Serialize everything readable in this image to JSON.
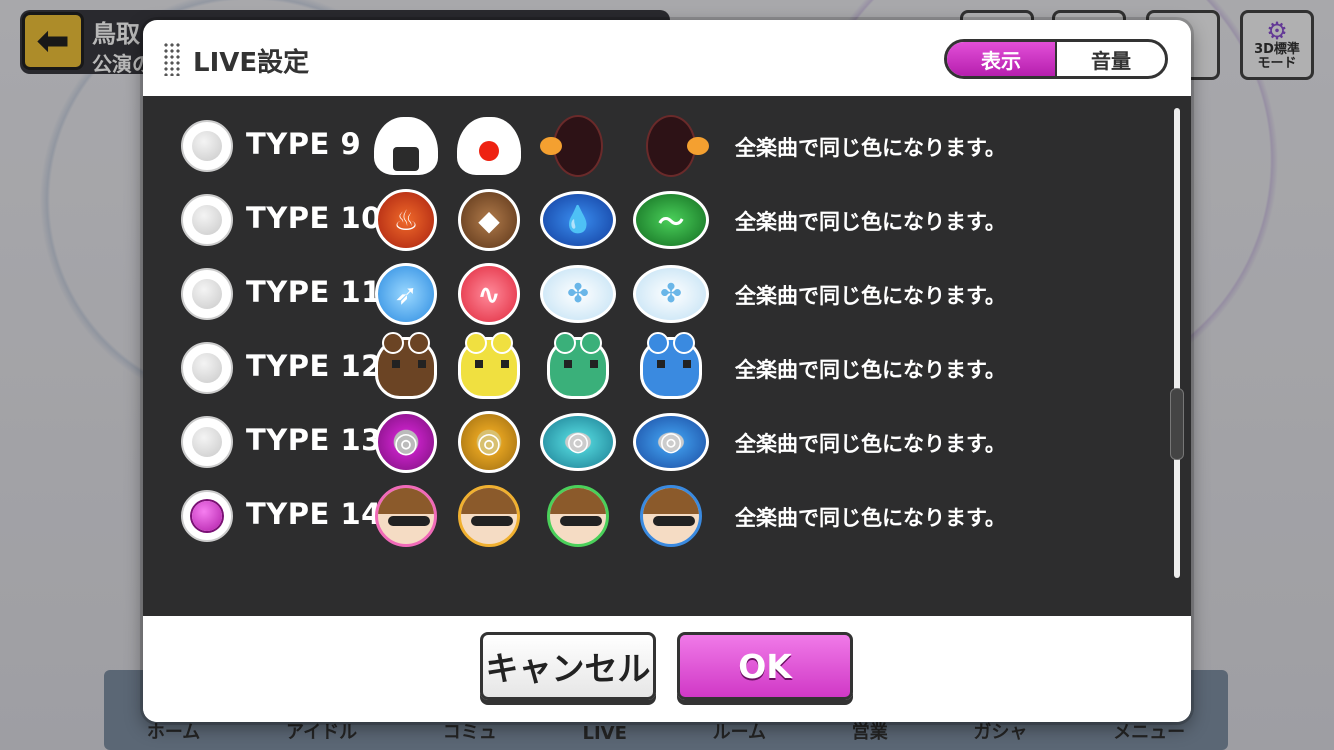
{
  "background": {
    "title": "鳥取",
    "subtitle": "公演の",
    "corner_button": "3D標準\nモード",
    "nav": [
      "ホーム",
      "アイドル",
      "コミュ",
      "LIVE",
      "ルーム",
      "営業",
      "ガシャ",
      "メニュー"
    ]
  },
  "dialog": {
    "title": "LIVE設定",
    "tabs": [
      {
        "label": "表示",
        "active": true
      },
      {
        "label": "音量",
        "active": false
      }
    ],
    "options": [
      {
        "label": "TYPE 9",
        "description": "全楽曲で同じ色になります。",
        "selected": false,
        "icons": [
          "onigiri-nori-icon",
          "onigiri-ume-icon",
          "onigiri-shrimp-left-icon",
          "onigiri-shrimp-right-icon"
        ]
      },
      {
        "label": "TYPE 10",
        "description": "全楽曲で同じ色になります。",
        "selected": false,
        "icons": [
          "fire-emblem-icon",
          "earth-emblem-icon",
          "water-emblem-icon",
          "wind-emblem-icon"
        ]
      },
      {
        "label": "TYPE 11",
        "description": "全楽曲で同じ色になります。",
        "selected": false,
        "icons": [
          "feather-icon",
          "pulse-icon",
          "butterfly-left-icon",
          "butterfly-right-icon"
        ]
      },
      {
        "label": "TYPE 12",
        "description": "全楽曲で同じ色になります。",
        "selected": false,
        "icons": [
          "brown-creature-icon",
          "yellow-creature-icon",
          "green-creature-icon",
          "blue-creature-icon"
        ]
      },
      {
        "label": "TYPE 13",
        "description": "全楽曲で同じ色になります。",
        "selected": false,
        "icons": [
          "purple-ring-icon",
          "gold-ring-icon",
          "teal-eye-icon",
          "blue-eye-icon"
        ]
      },
      {
        "label": "TYPE 14",
        "description": "全楽曲で同じ色になります。",
        "selected": true,
        "icons": [
          "face-pink-icon",
          "face-gold-icon",
          "face-green-icon",
          "face-blue-icon"
        ]
      }
    ],
    "cancel_label": "キャンセル",
    "ok_label": "OK"
  },
  "colors": {
    "accent": "#d038c6",
    "list_bg": "#141416"
  }
}
